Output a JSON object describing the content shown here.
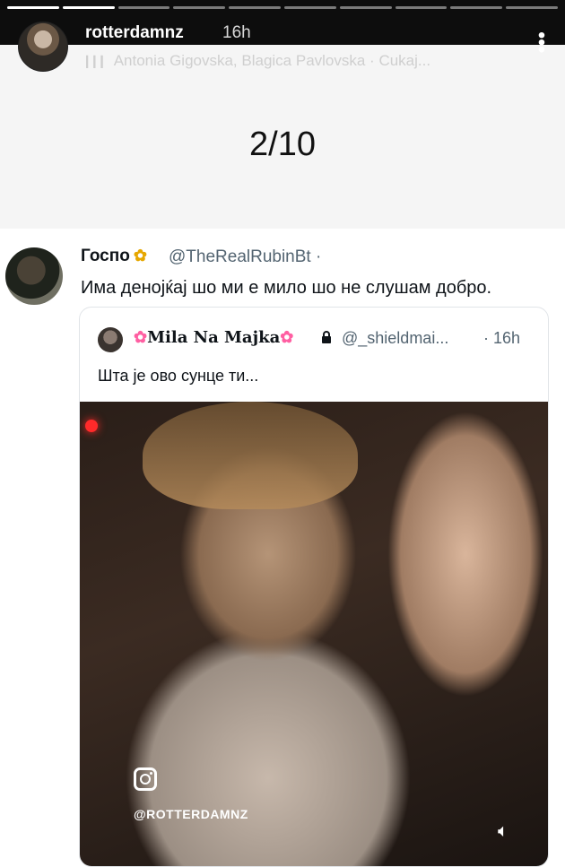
{
  "story": {
    "username": "rotterdamnz",
    "time": "16h",
    "music": "Antonia Gigovska, Blagica Pavlovska · Cukaj...",
    "counter": "2/10",
    "progress_total": 10,
    "progress_current": 2
  },
  "tweet": {
    "display_name": "Госпо",
    "handle": "@TheRealRubinBt ·",
    "text": "Има денојќај шо ми е мило шо не слушам добро."
  },
  "quote": {
    "display_name": "Mila Na Majka",
    "handle": "@_shieldmai...",
    "time": "· 16h",
    "text": "Шта је ово сунце ти..."
  },
  "media": {
    "watermark": "@ROTTERDAMNZ"
  },
  "colors": {
    "story_bar": "#0d0d0d",
    "counter_bg": "#f5f5f5",
    "muted_text": "#536471"
  }
}
